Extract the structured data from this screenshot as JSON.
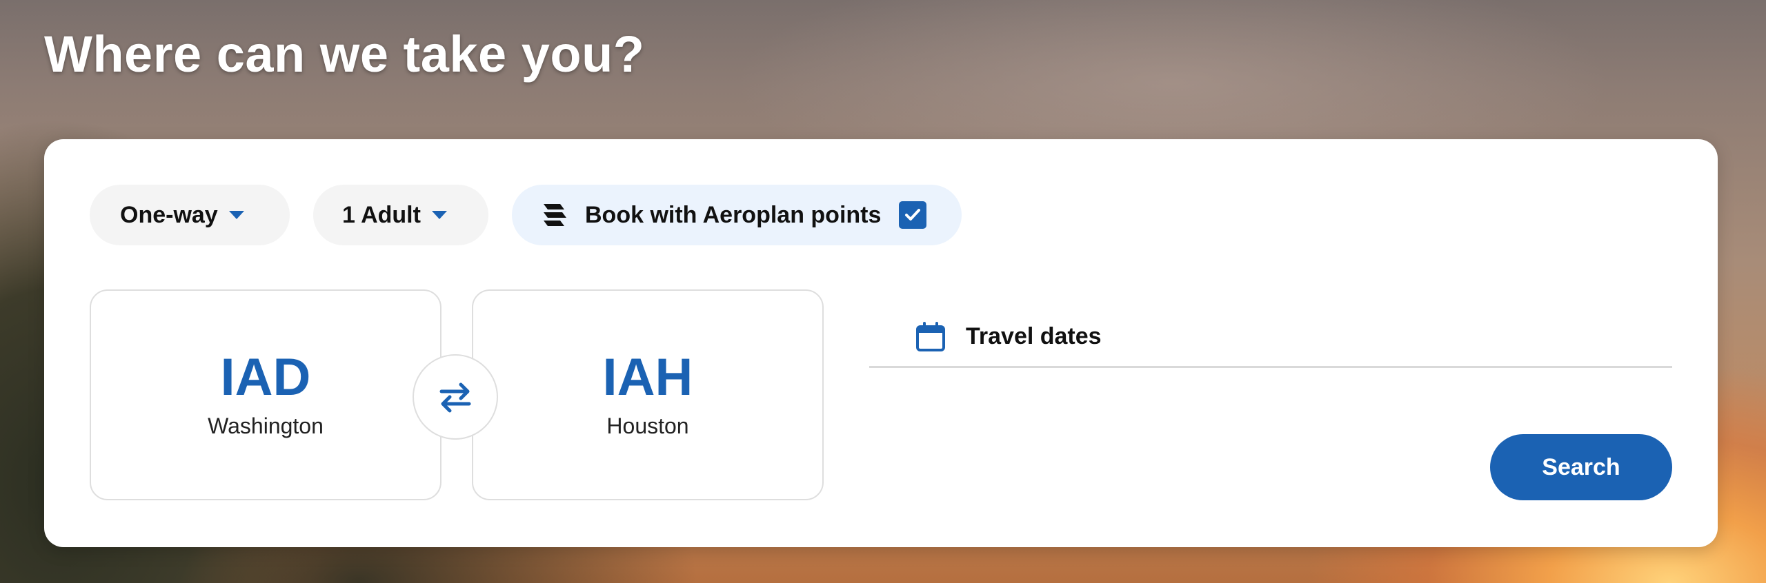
{
  "page": {
    "title": "Where can we take you?"
  },
  "booking": {
    "trip_type": "One-way",
    "passengers": "1 Adult",
    "aeroplan_label": "Book with Aeroplan points",
    "aeroplan_checked": true,
    "origin": {
      "code": "IAD",
      "city": "Washington"
    },
    "destination": {
      "code": "IAH",
      "city": "Houston"
    },
    "dates_label": "Travel dates",
    "search_label": "Search"
  },
  "icons": {
    "caret": "chevron-down-icon",
    "aeroplan": "aeroplan-logo-icon",
    "checkbox": "checkmark-icon",
    "swap": "swap-arrows-icon",
    "calendar": "calendar-icon"
  },
  "colors": {
    "accent": "#1b62b3",
    "card_bg": "#ffffff",
    "pill_bg": "#f4f4f4",
    "aeroplan_pill_bg": "#ebf3fd"
  }
}
